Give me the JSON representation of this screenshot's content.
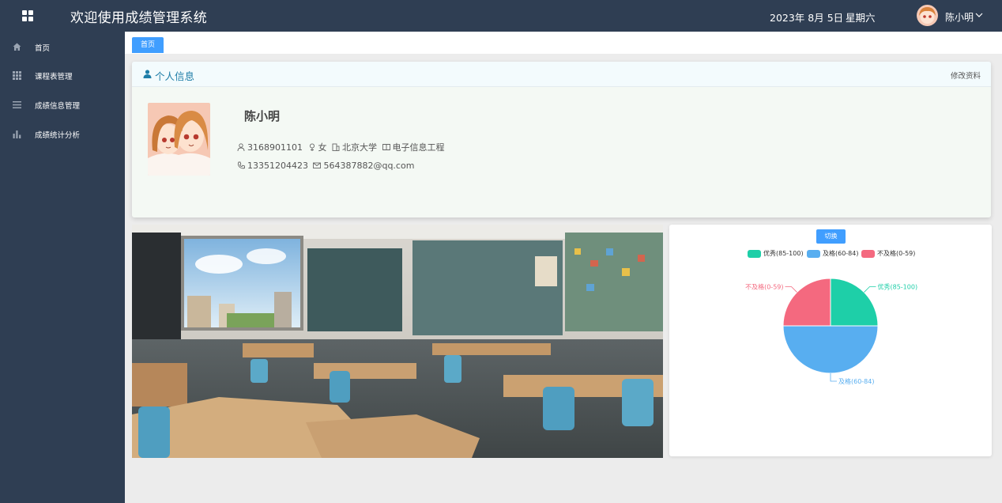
{
  "header": {
    "app_title": "欢迎使用成绩管理系统",
    "date": "2023年 8月 5日",
    "weekday": "星期六",
    "user_name": "陈小明"
  },
  "sidebar": {
    "items": [
      {
        "label": "首页",
        "icon": "home-icon"
      },
      {
        "label": "课程表管理",
        "icon": "grid-icon"
      },
      {
        "label": "成绩信息管理",
        "icon": "list-icon"
      },
      {
        "label": "成绩统计分析",
        "icon": "bar-chart-icon"
      }
    ]
  },
  "tabs": [
    {
      "label": "首页"
    }
  ],
  "profile": {
    "section_title": "个人信息",
    "edit_label": "修改资料",
    "name": "陈小明",
    "student_id": "3168901101",
    "gender": "女",
    "school": "北京大学",
    "major": "电子信息工程",
    "phone": "13351204423",
    "email": "564387882@qq.com"
  },
  "chart_panel": {
    "switch_label": "切换"
  },
  "chart_data": {
    "type": "pie",
    "legend_placement": "top-center",
    "categories": [
      "优秀(85-100)",
      "及格(60-84)",
      "不及格(0-59)"
    ],
    "values": [
      1,
      2,
      1
    ],
    "colors": [
      "#1ecfa8",
      "#58aef0",
      "#f4697f"
    ]
  },
  "colors": {
    "topbar": "#2f3e53",
    "sidebar": "#2f3e53",
    "accent": "#409eff"
  }
}
